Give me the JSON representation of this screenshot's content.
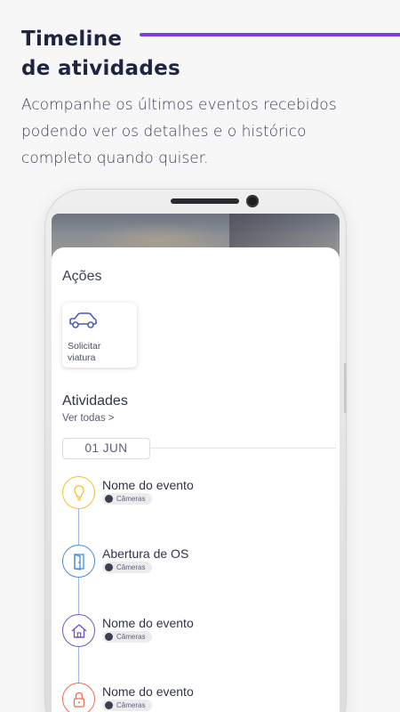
{
  "header": {
    "title_line1": "Timeline",
    "title_line2": "de atividades",
    "accent_color": "#7b3fe4",
    "subtitle_line1": "Acompanhe os últimos eventos recebidos",
    "subtitle_line2": "podendo ver os detalhes e o histórico",
    "subtitle_line3": "completo quando quiser."
  },
  "app": {
    "acoes_heading": "Ações",
    "action_card": {
      "icon": "car-icon",
      "label_line1": "Solicitar",
      "label_line2": "viatura"
    },
    "atividades_heading": "Atividades",
    "ver_todas": "Ver todas >",
    "date_label": "01 JUN",
    "events": [
      {
        "title": "Nome do evento",
        "tag": "Câmeras",
        "icon": "lightbulb-icon",
        "color": "#f2c230"
      },
      {
        "title": "Abertura de OS",
        "tag": "Câmeras",
        "icon": "door-icon",
        "color": "#3e8fe0"
      },
      {
        "title": "Nome do evento",
        "tag": "Câmeras",
        "icon": "home-icon",
        "color": "#6f56c9"
      },
      {
        "title": "Nome do evento",
        "tag": "Câmeras",
        "icon": "lock-icon",
        "color": "#ec6a50"
      }
    ]
  }
}
